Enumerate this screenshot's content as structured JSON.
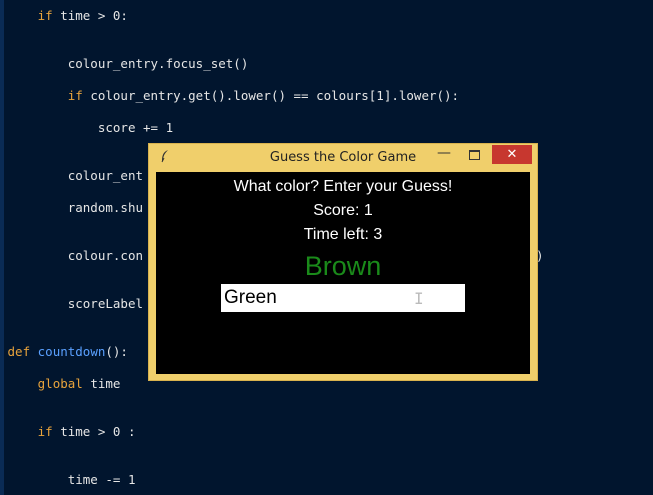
{
  "editor": {
    "lines": [
      {
        "indent": "     ",
        "tokens": [
          {
            "kw": "if"
          },
          {
            "t": " time > 0:"
          }
        ]
      },
      {
        "indent": "         ",
        "tokens": [
          {
            "t": "colour_entry.focus_set()"
          }
        ]
      },
      {
        "indent": "         ",
        "tokens": [
          {
            "kw": "if"
          },
          {
            "t": " colour_entry.get().lower() == colours[1].lower():"
          }
        ]
      },
      {
        "indent": "             ",
        "tokens": [
          {
            "t": "score += 1"
          }
        ]
      },
      {
        "indent": "         ",
        "tokens": [
          {
            "t": "colour_ent"
          }
        ]
      },
      {
        "indent": "         ",
        "tokens": [
          {
            "t": "random.shu"
          }
        ]
      },
      {
        "indent": "         ",
        "tokens": [
          {
            "t": "colour.con"
          }
        ]
      },
      {
        "indent": "         ",
        "tokens": [
          {
            "t": "scoreLabel"
          }
        ]
      },
      {
        "indent": " ",
        "tokens": [
          {
            "kw": "def"
          },
          {
            "t": " "
          },
          {
            "fn": "countdown"
          },
          {
            "t": "():"
          }
        ]
      },
      {
        "indent": "     ",
        "tokens": [
          {
            "kw": "global"
          },
          {
            "t": " time"
          }
        ]
      },
      {
        "indent": "     ",
        "tokens": [
          {
            "kw": "if"
          },
          {
            "t": " time > 0 :"
          }
        ]
      },
      {
        "indent": "         ",
        "tokens": [
          {
            "t": "time -= 1"
          }
        ]
      }
    ],
    "fragments": [
      ")"
    ]
  },
  "window": {
    "title": "Guess the Color Game",
    "min_glyph": "—",
    "close_glyph": "✕"
  },
  "game": {
    "instructions": "What color? Enter your Guess!",
    "score_text": "Score: 1",
    "time_text": "Time left: 3",
    "colour_word": "Brown",
    "colour_word_color": "#1a8a1a",
    "entry_value": "Green"
  },
  "colors": {
    "editor_bg": "#01152e",
    "keyword": "#e8a33c",
    "function": "#5aa0ff",
    "window_frame": "#f0cf6b",
    "close_button": "#c7372f"
  }
}
